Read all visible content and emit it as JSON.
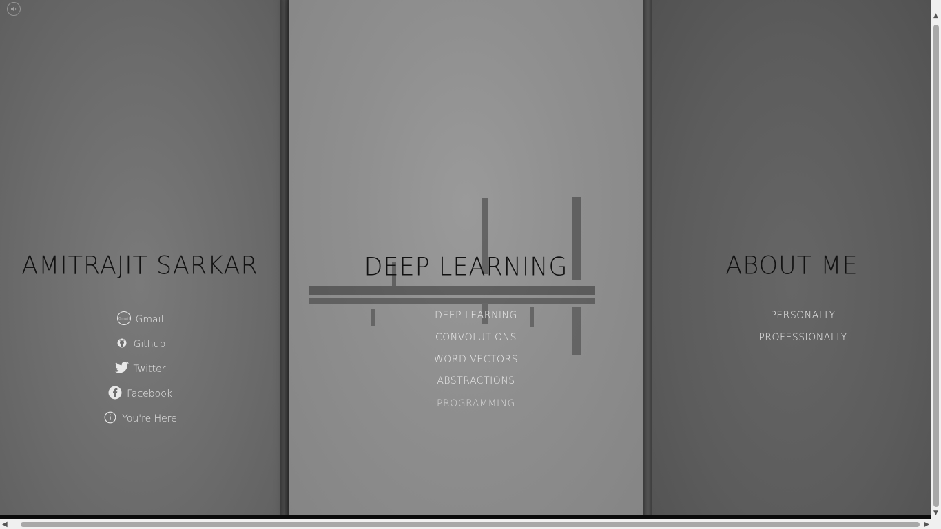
{
  "left_panel": {
    "title": "AMITRAJIT SARKAR",
    "links": [
      {
        "label": "Gmail",
        "icon": "gmail-icon"
      },
      {
        "label": "Github",
        "icon": "github-icon"
      },
      {
        "label": "Twitter",
        "icon": "twitter-icon"
      },
      {
        "label": "Facebook",
        "icon": "facebook-icon"
      },
      {
        "label": "You're Here",
        "icon": "info-icon"
      }
    ],
    "gmail_icon_text": "Gmail"
  },
  "center_panel": {
    "title": "DEEP LEARNING",
    "menu": [
      "DEEP LEARNING",
      "CONVOLUTIONS",
      "WORD VECTORS",
      "ABSTRACTIONS",
      "PROGRAMMING"
    ]
  },
  "right_panel": {
    "title": "ABOUT ME",
    "menu": [
      "PERSONALLY",
      "PROFESSIONALLY"
    ]
  },
  "controls": {
    "sound_icon": "speaker-icon"
  },
  "colors": {
    "title": "#111111",
    "link_text": "#e8e8e8",
    "left_bg": "#6c6c6c",
    "center_bg": "#8f8f8f",
    "right_bg": "#5c5c5c"
  }
}
